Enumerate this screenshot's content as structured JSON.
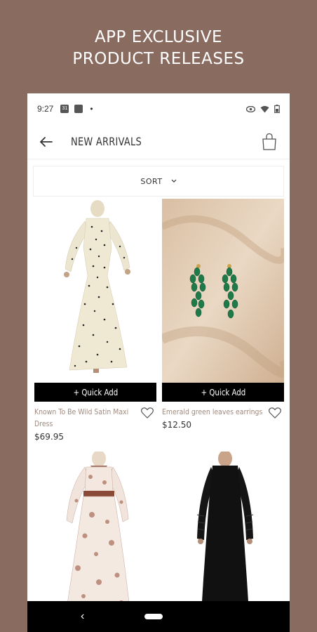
{
  "promo": {
    "line1": "APP EXCLUSIVE",
    "line2": "PRODUCT RELEASES"
  },
  "status_bar": {
    "time": "9:27",
    "calendar_badge": "31",
    "icons": [
      "calendar-icon",
      "square-icon",
      "dot-icon",
      "eye-icon",
      "wifi-icon",
      "battery-icon"
    ]
  },
  "header": {
    "title": "NEW ARRIVALS"
  },
  "sort": {
    "label": "SORT"
  },
  "products": [
    {
      "name": "Known To Be Wild Satin Maxi Dress",
      "price": "$69.95",
      "quick_add": "+ Quick Add"
    },
    {
      "name": "Emerald green leaves earrings",
      "price": "$12.50",
      "quick_add": "+ Quick Add"
    },
    {
      "name": "",
      "price": "",
      "quick_add": ""
    },
    {
      "name": "",
      "price": "",
      "quick_add": ""
    }
  ],
  "colors": {
    "background": "#8a6b60",
    "name_text": "#a08a7e",
    "quick_add_bg": "#000000"
  }
}
